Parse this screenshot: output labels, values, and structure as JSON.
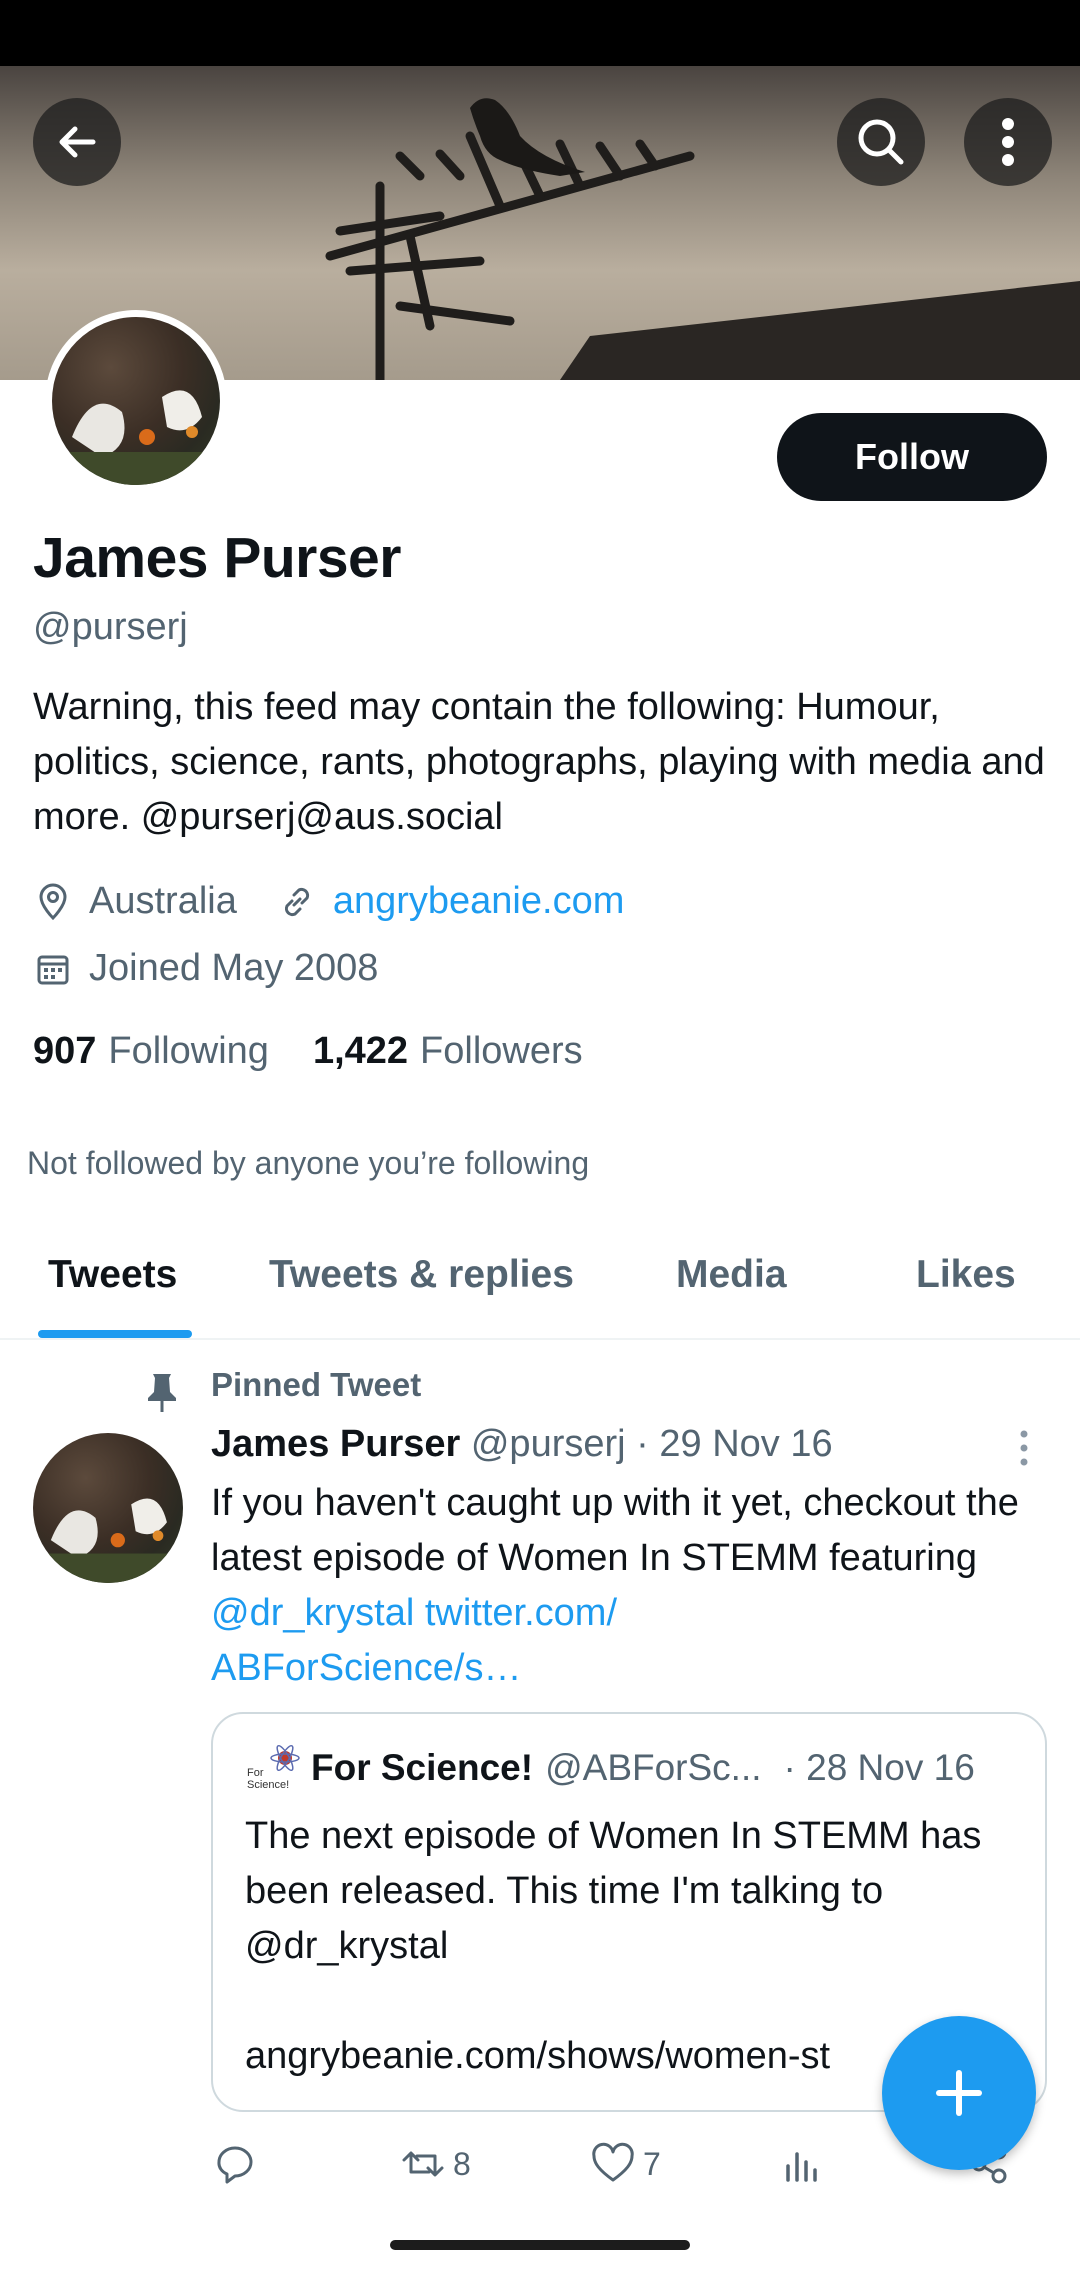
{
  "profile": {
    "name": "James Purser",
    "handle": "@purserj",
    "bio": "Warning, this feed may contain the following:  Humour, politics, science, rants, photographs, playing with media and more.  @purserj@aus.social",
    "location": "Australia",
    "website": "angrybeanie.com",
    "joined": "Joined May 2008",
    "following_count": "907",
    "following_label": "Following",
    "followers_count": "1,422",
    "followers_label": "Followers",
    "not_followed": "Not followed by anyone you’re following",
    "follow_label": "Follow"
  },
  "tabs": [
    "Tweets",
    "Tweets & replies",
    "Media",
    "Likes"
  ],
  "active_tab": "Tweets",
  "pinned_tweet": {
    "pinned_label": "Pinned Tweet",
    "author_name": "James Purser",
    "author_handle": "@purserj",
    "date": "· 29 Nov 16",
    "text_plain": "If you haven't caught up with it yet, checkout the latest episode of Women In STEMM featuring ",
    "mention": "@dr_krystal",
    "link_1": "twitter.com/",
    "link_2": "ABForScience/s…",
    "quote": {
      "author_name": "For Science!",
      "author_handle": "@ABForSc...",
      "date": "· 28 Nov 16",
      "text": "The next episode of Women In STEMM has been released. This time I'm talking to @dr_krystal\n\nangrybeanie.com/shows/women-st"
    },
    "retweets": "8",
    "likes": "7"
  },
  "colors": {
    "accent": "#1d9bf0",
    "text_primary": "#0f1419",
    "text_secondary": "#536471",
    "follow_button": "#0f1419"
  },
  "icons": [
    "back-arrow-icon",
    "search-icon",
    "more-vertical-icon",
    "location-pin-icon",
    "link-icon",
    "calendar-icon",
    "pin-icon",
    "reply-icon",
    "retweet-icon",
    "like-icon",
    "analytics-icon",
    "share-icon",
    "plus-icon"
  ]
}
